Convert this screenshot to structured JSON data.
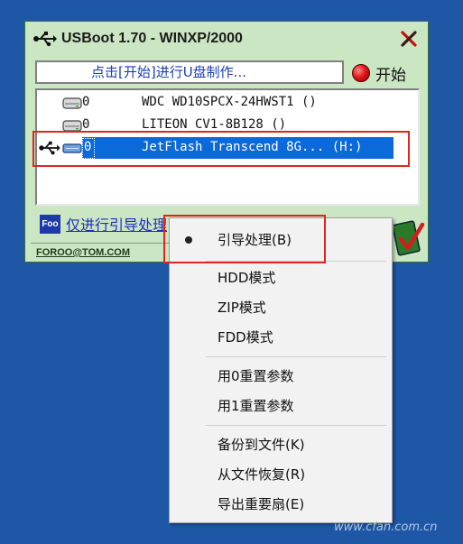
{
  "window": {
    "title": "USBoot 1.70 - WINXP/2000",
    "status_text": "点击[开始]进行U盘制作...",
    "start_label": "开始",
    "bottom_link": "仅进行引导处理",
    "footer_email": "FOROO@TOM.COM",
    "brand_icon_text": "Foo"
  },
  "devices": [
    {
      "num": "0",
      "name": "WDC WD10SPCX-24HWST1 ()",
      "selected": false
    },
    {
      "num": "0",
      "name": "LITEON CV1-8B128 ()",
      "selected": false
    },
    {
      "num": "0",
      "name": "JetFlash Transcend 8G... (H:)",
      "selected": true
    }
  ],
  "context_menu": {
    "checked_item": "引导处理(B)",
    "group1": [
      "HDD模式",
      "ZIP模式",
      "FDD模式"
    ],
    "group2": [
      "用0重置参数",
      "用1重置参数"
    ],
    "group3": [
      "备份到文件(K)",
      "从文件恢复(R)",
      "导出重要扇(E)"
    ]
  },
  "watermark": "www.cfan.com.cn",
  "colors": {
    "desktop": "#1f57a7",
    "window_bg": "#cbe6c2",
    "selection": "#0c69d9",
    "highlight_border": "#e02424",
    "link": "#1f2fb8"
  }
}
